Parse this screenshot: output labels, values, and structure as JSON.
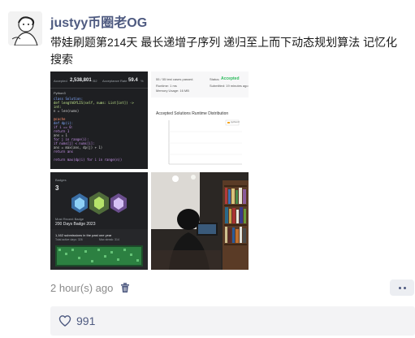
{
  "post": {
    "author": "justyy币圈老OG",
    "text": "带娃刷题第214天 最长递增子序列 递归至上而下动态规划算法 记忆化搜索",
    "time": "2 hour(s) ago",
    "likes": "991"
  },
  "images": {
    "code": {
      "accepted_label": "Accepted",
      "accepted_value": "2,538,801",
      "accepted_unit": "/52",
      "rate_label": "Acceptance Rate",
      "rate_value": "59.4",
      "rate_unit": "%",
      "tab": "Python3",
      "lines": [
        "class Solution:",
        "  def lengthOfLIS(self, nums: List[int]) ->",
        "    int:",
        "      n = len(nums)",
        "",
        "      @cache",
        "      def dp(i):",
        "        if i == 0:",
        "          return 1",
        "        ans = 1",
        "        for j in range(i):",
        "          if nums[j] < nums[i]:",
        "            ans = max(ans, dp(j) + 1)",
        "        return ans",
        "",
        "      return max(dp(i) for i in range(n))"
      ]
    },
    "result": {
      "passed": "55 / 55 test cases passed.",
      "status_label": "Status:",
      "status_value": "Accepted",
      "runtime": "Runtime: 1 ms",
      "memory": "Memory Usage: 16 MB",
      "submitted": "Submitted: 19 minutes ago",
      "chart_title": "Accepted Solutions Runtime Distribution",
      "legend": "python3"
    },
    "badges": {
      "header": "Badges",
      "count": "3",
      "recent_label": "Most Recent Badge",
      "recent_name": "200 Days Badge 2023",
      "submissions": "1,162 submissions in the past one year",
      "active_days": "Total active days: 326",
      "max_streak": "Max streak: 314"
    }
  }
}
